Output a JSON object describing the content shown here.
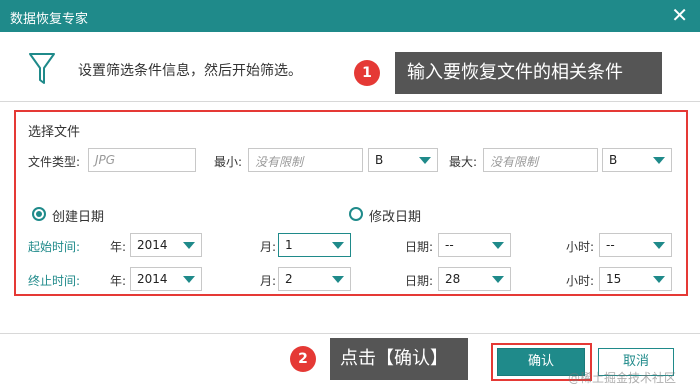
{
  "window": {
    "title": "数据恢复专家",
    "close_glyph": "✕"
  },
  "intro_text": "设置筛选条件信息，然后开始筛选。",
  "callouts": [
    {
      "number": "1",
      "text": "输入要恢复文件的相关条件"
    },
    {
      "number": "2",
      "text": "点击【确认】"
    }
  ],
  "select_file": {
    "title": "选择文件",
    "file_type_label": "文件类型:",
    "file_type_placeholder": "JPG",
    "min_label": "最小:",
    "min_placeholder": "没有限制",
    "min_unit": "B",
    "max_label": "最大:",
    "max_placeholder": "没有限制",
    "max_unit": "B"
  },
  "date_mode": {
    "created_label": "创建日期",
    "created_checked": true,
    "modified_label": "修改日期",
    "modified_checked": false
  },
  "start_time": {
    "label": "起始时间:",
    "year_label": "年:",
    "year": "2014",
    "month_label": "月:",
    "month": "1",
    "day_label": "日期:",
    "day": "--",
    "hour_label": "小时:",
    "hour": "--"
  },
  "end_time": {
    "label": "终止时间:",
    "year_label": "年:",
    "year": "2014",
    "month_label": "月:",
    "month": "2",
    "day_label": "日期:",
    "day": "28",
    "hour_label": "小时:",
    "hour": "15"
  },
  "buttons": {
    "ok": "确认",
    "cancel": "取消"
  },
  "watermark": "@稀土掘金技术社区",
  "colors": {
    "accent": "#1f8a8a",
    "highlight": "#e53935",
    "callout_bg": "#555555"
  }
}
